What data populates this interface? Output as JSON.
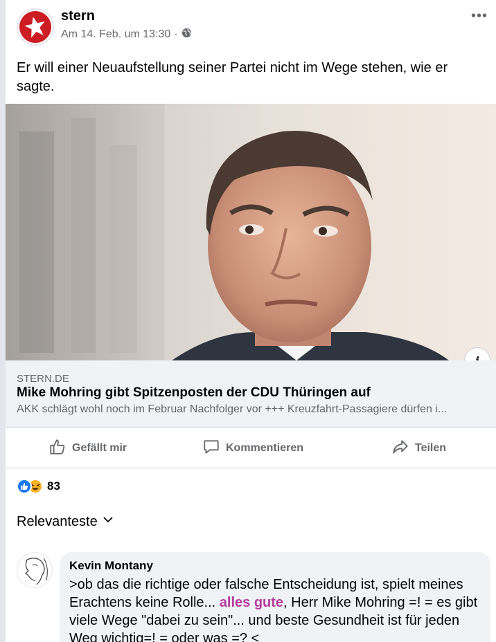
{
  "post": {
    "page_name": "stern",
    "timestamp": "Am 14. Feb. um 13:30",
    "separator": "·",
    "audience_icon": "globe-icon",
    "more_label": "•••",
    "text": "Er will einer Neuaufstellung seiner Partei nicht im Wege stehen, wie er sagte."
  },
  "link": {
    "domain": "STERN.DE",
    "title": "Mike Mohring gibt Spitzenposten der CDU Thüringen auf",
    "description": "AKK schlägt wohl noch im Februar Nachfolger vor +++ Kreuzfahrt-Passagiere dürfen i...",
    "info_label": "i"
  },
  "actions": {
    "like": "Gefällt mir",
    "comment": "Kommentieren",
    "share": "Teilen"
  },
  "reactions": {
    "count": "83",
    "types": [
      "like-icon",
      "haha-icon"
    ]
  },
  "sort_label": "Relevanteste",
  "comment": {
    "author": "Kevin Montany",
    "text_1": ">ob das die richtige oder falsche Entscheidung ist, spielt meines Erachtens keine Rolle... ",
    "highlight": "alles gute",
    "text_2": ", Herr Mike Mohring =! = es gibt viele Wege \"dabei zu sein\"... und beste Gesundheit ist für jeden Weg wichtig=! = oder was =? <"
  },
  "colors": {
    "brand_red": "#cc1c24",
    "facebook_blue": "#1877f2",
    "highlight_pink": "#b5399f",
    "secondary_text": "#65676b"
  }
}
